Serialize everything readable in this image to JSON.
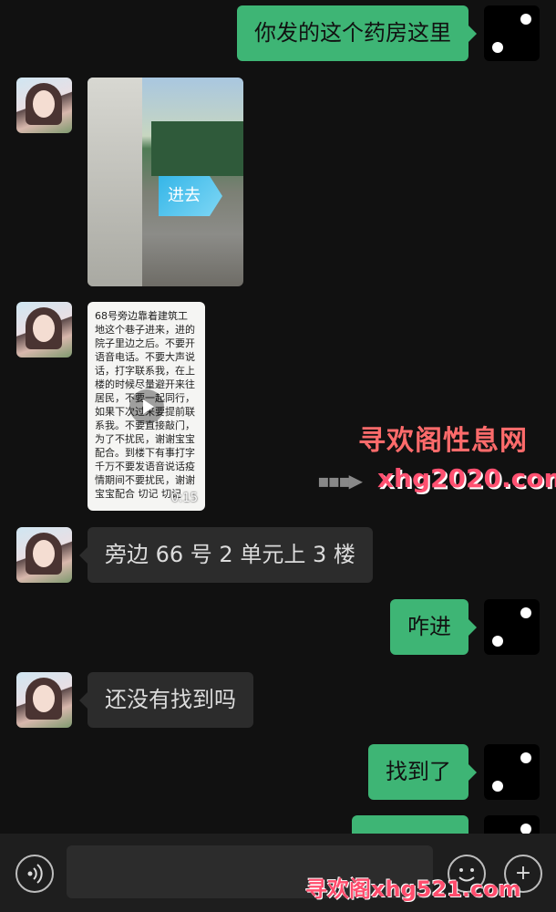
{
  "messages": [
    {
      "side": "right",
      "text": "你发的这个药房这里"
    },
    {
      "side": "left",
      "type": "image",
      "label": "进去"
    },
    {
      "side": "left",
      "type": "video",
      "text": "68号旁边靠着建筑工\n地这个巷子进来，进的\n院子里边之后。不要开\n语音电话。不要大声说\n话，打字联系我，在上\n楼的时候尽量避开来往\n居民，不要一起同行，\n如果下次过来要提前联\n系我。不要直接敲门，\n为了不扰民，谢谢宝宝\n配合。到楼下有事打字\n千万不要发语音说话疫\n情期间不要扰民，谢谢\n宝宝配合 切记 切记",
      "duration": "0:15"
    },
    {
      "side": "left",
      "text": "旁边 66 号 2 单元上 3 楼"
    },
    {
      "side": "right",
      "text": "咋进"
    },
    {
      "side": "left",
      "text": "还没有找到吗"
    },
    {
      "side": "right",
      "text": "找到了"
    }
  ],
  "watermarks": {
    "title": "寻欢阁性息网",
    "arrow": "▪▪▪▶",
    "site": "xhg2020.com",
    "bottom": "寻欢阁xhg521.com"
  },
  "toolbar": {
    "voice_icon": "voice-icon",
    "emoji_icon": "emoji-icon",
    "plus_icon": "plus-icon",
    "plus_glyph": "+"
  },
  "colors": {
    "background": "#111111",
    "bubble_sent": "#3eb575",
    "bubble_received": "#2c2c2c"
  }
}
